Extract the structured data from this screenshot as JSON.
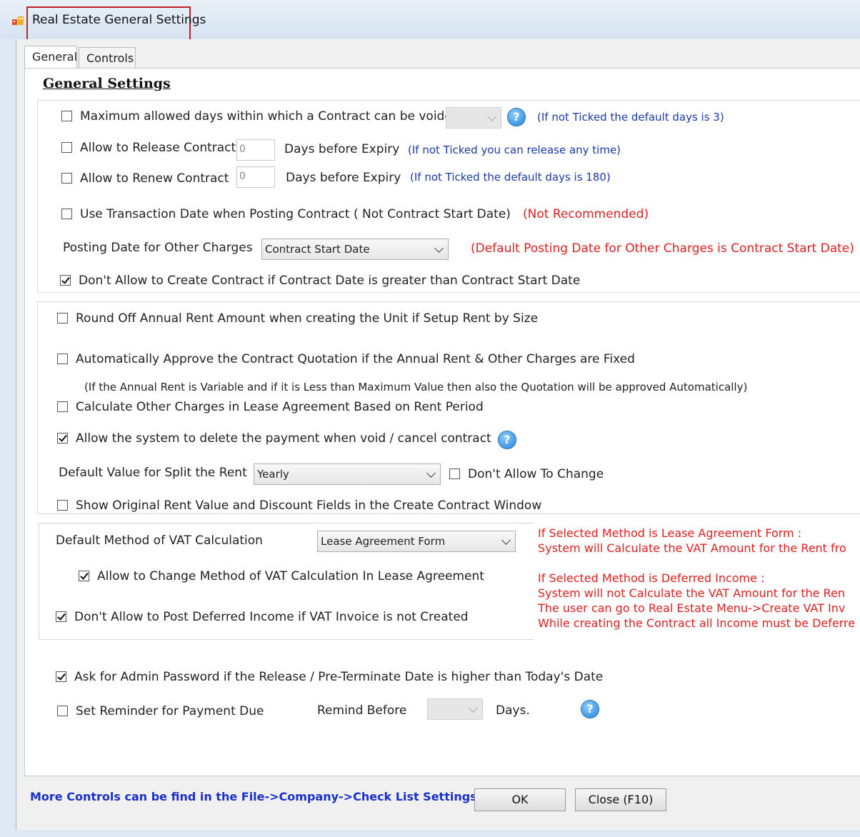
{
  "window": {
    "title": "Real Estate General Settings",
    "icon": "app-icon"
  },
  "tabs": [
    {
      "label": "General",
      "active": true
    },
    {
      "label": "Controls",
      "active": false
    }
  ],
  "section_title": "General Settings",
  "contract": {
    "max_void": {
      "label": "Maximum allowed days within which a Contract can be voided",
      "checked": false,
      "value": "",
      "note": "(If not Ticked the default days is 3)"
    },
    "release": {
      "label": "Allow to Release Contract",
      "checked": false,
      "value": "0",
      "suffix": "Days before Expiry",
      "note": "(If not Ticked you can release any time)"
    },
    "renew": {
      "label": "Allow to Renew Contract",
      "checked": false,
      "value": "0",
      "suffix": "Days before Expiry",
      "note": "(If not Ticked the default days is 180)"
    },
    "transaction_date": {
      "label": "Use Transaction Date when Posting Contract ( Not Contract Start Date)",
      "checked": false,
      "note": "(Not Recommended)"
    },
    "posting_date": {
      "label": "Posting Date for Other Charges",
      "value": "Contract Start Date",
      "note": "(Default Posting Date for Other Charges is Contract Start Date)"
    },
    "dont_allow_contract": {
      "label": "Don't Allow to Create Contract if Contract Date is greater than Contract Start Date",
      "checked": true
    }
  },
  "rent": {
    "round_off": {
      "label": "Round Off Annual Rent Amount when creating the Unit if Setup Rent by Size",
      "checked": false
    },
    "auto_approve": {
      "label": "Automatically Approve the Contract Quotation if the Annual Rent & Other Charges are Fixed",
      "checked": false,
      "note": "(If the Annual Rent is Variable and if it is Less than Maximum Value then also the Quotation will be approved Automatically)"
    },
    "calc_other": {
      "label": "Calculate Other Charges in Lease Agreement Based on Rent Period",
      "checked": false
    },
    "delete_payment": {
      "label": "Allow the system to delete the payment when void / cancel contract",
      "checked": true
    },
    "split_rent": {
      "label": "Default Value for Split the Rent",
      "value": "Yearly",
      "dont_allow_label": "Don't Allow To Change",
      "dont_allow_checked": false
    },
    "show_original": {
      "label": "Show Original Rent Value and Discount Fields in the Create Contract Window",
      "checked": false
    }
  },
  "vat": {
    "method": {
      "label": "Default Method of VAT Calculation",
      "value": "Lease Agreement Form"
    },
    "allow_change": {
      "label": "Allow to Change Method of VAT Calculation In Lease Agreement",
      "checked": true
    },
    "dont_post": {
      "label": "Don't Allow to Post Deferred Income if VAT Invoice is not Created",
      "checked": true
    },
    "info_lines": [
      "If Selected Method is Lease Agreement Form :",
      "System will Calculate the VAT Amount for the Rent fro",
      "If Selected Method is Deferred Income :",
      "System will not Calculate the VAT Amount for the Ren",
      "The user can go to Real Estate Menu->Create VAT Inv",
      "While creating the Contract all Income must be Deferre"
    ]
  },
  "misc": {
    "admin_password": {
      "label": "Ask for Admin Password if the Release / Pre-Terminate Date is higher than Today's Date",
      "checked": true
    },
    "reminder": {
      "label": "Set Reminder for Payment Due",
      "checked": false,
      "remind_label": "Remind Before",
      "value": "",
      "days_label": "Days."
    }
  },
  "footer": {
    "link": "More Controls can be find in the File->Company->Check List Settings",
    "ok_label": "OK",
    "close_label": "Close (F10)"
  },
  "icons": {
    "help": "help-icon",
    "question_mark": "?"
  }
}
